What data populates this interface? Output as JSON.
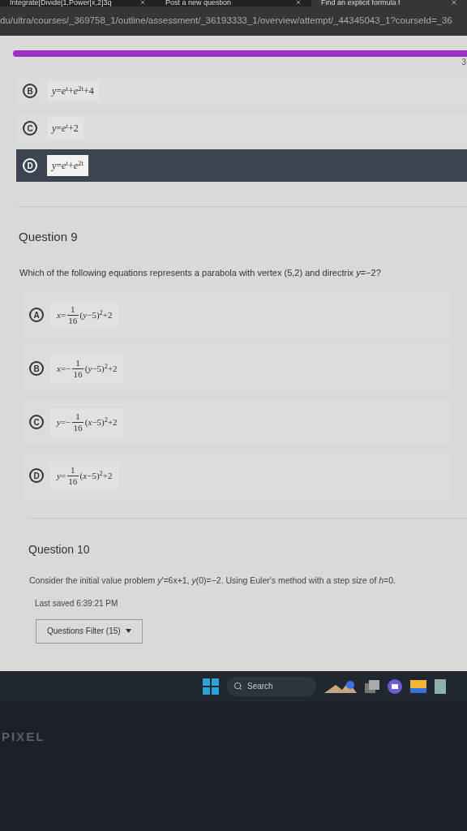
{
  "browser": {
    "tabs": [
      {
        "title": "Integrate[Divide[1,Power[x,2]3q",
        "selected": false
      },
      {
        "title": "Post a new question",
        "selected": false
      },
      {
        "title": "Find an explicit formula f",
        "selected": true
      }
    ],
    "url": "du/ultra/courses/_369758_1/outline/assessment/_36193333_1/overview/attempt/_44345043_1?courseId=_36"
  },
  "progress": {
    "level": 1,
    "counter": "3"
  },
  "previous_question": {
    "options": [
      {
        "letter": "B",
        "equation": "*y*=*e*$^{t}$+*e*$^{2t}$+4",
        "selected": false
      },
      {
        "letter": "C",
        "equation": "*y*=*e*$^{t}$+2",
        "selected": false
      },
      {
        "letter": "D",
        "equation": "*y*=*e*$^{t}$+*e*$^{2t}$",
        "selected": true
      }
    ]
  },
  "question_9": {
    "title": "Question 9",
    "prompt": "Which of the following equations represents a parabola with vertex (5,2) and directrix *y*=−2?",
    "options": [
      {
        "letter": "A",
        "lhs": "*x*=",
        "numerator": "1",
        "denominator": "16",
        "rest": "(*y*−5)$^{2}$+2",
        "selected": false
      },
      {
        "letter": "B",
        "lhs": "*x*=−",
        "numerator": "1",
        "denominator": "16",
        "rest": "(*y*−5)$^{2}$+2",
        "selected": false
      },
      {
        "letter": "C",
        "lhs": "*y*=−",
        "numerator": "1",
        "denominator": "16",
        "rest": "(*x*−5)$^{2}$+2",
        "selected": false
      },
      {
        "letter": "D",
        "lhs": "*y*=",
        "numerator": "1",
        "denominator": "16",
        "rest": "(*x*−5)$^{2}$+2",
        "selected": false
      }
    ]
  },
  "question_10": {
    "title": "Question 10",
    "prompt": "Consider the initial value problem *y*'=6x+1, *y*(0)=−2. Using Euler's method with a step size of *h*=0."
  },
  "last_saved": "Last saved 6:39:21 PM",
  "filter_button": "Questions Filter (15)",
  "taskbar": {
    "search": "Search"
  },
  "bezel": {
    "brand": "PIXEL"
  }
}
